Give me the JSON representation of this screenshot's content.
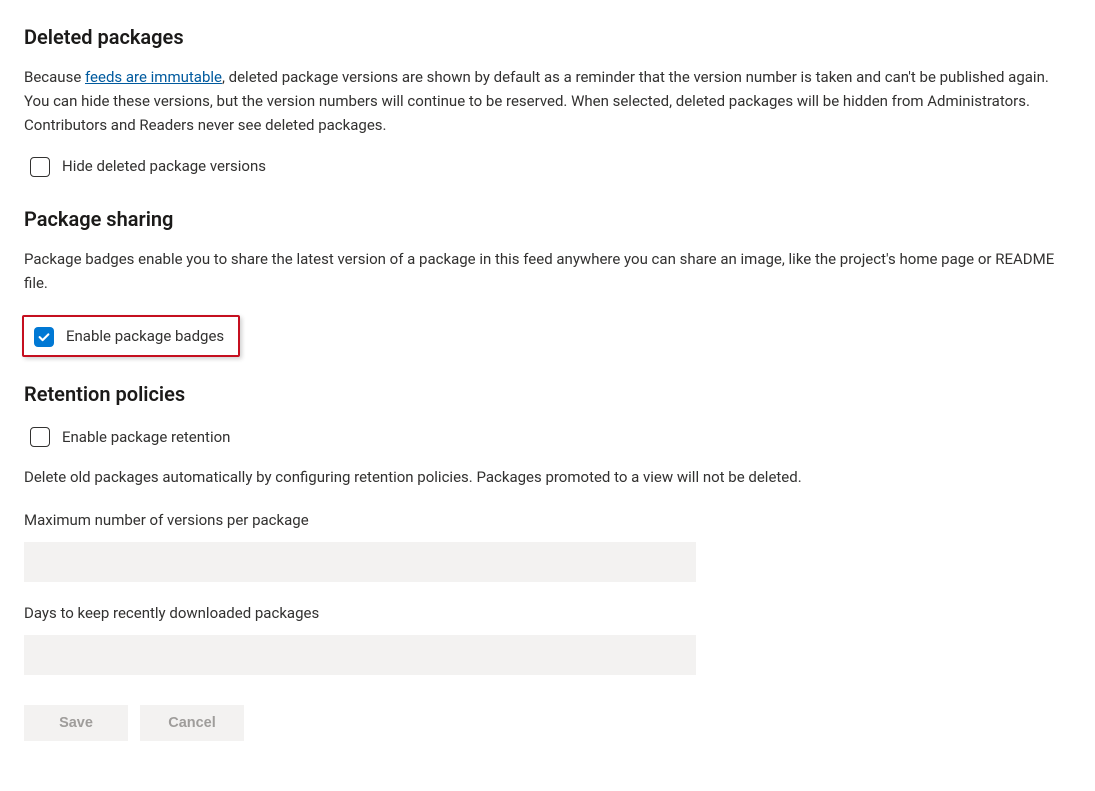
{
  "sections": {
    "deleted": {
      "title": "Deleted packages",
      "desc_prefix": "Because ",
      "link_text": "feeds are immutable",
      "desc_suffix": ", deleted package versions are shown by default as a reminder that the version number is taken and can't be published again. You can hide these versions, but the version numbers will continue to be reserved. When selected, deleted packages will be hidden from Administrators. Contributors and Readers never see deleted packages.",
      "checkbox_label": "Hide deleted package versions"
    },
    "sharing": {
      "title": "Package sharing",
      "desc": "Package badges enable you to share the latest version of a package in this feed anywhere you can share an image, like the project's home page or README file.",
      "checkbox_label": "Enable package badges"
    },
    "retention": {
      "title": "Retention policies",
      "checkbox_label": "Enable package retention",
      "desc": "Delete old packages automatically by configuring retention policies. Packages promoted to a view will not be deleted.",
      "field1_label": "Maximum number of versions per package",
      "field1_value": "",
      "field2_label": "Days to keep recently downloaded packages",
      "field2_value": ""
    }
  },
  "buttons": {
    "save": "Save",
    "cancel": "Cancel"
  }
}
